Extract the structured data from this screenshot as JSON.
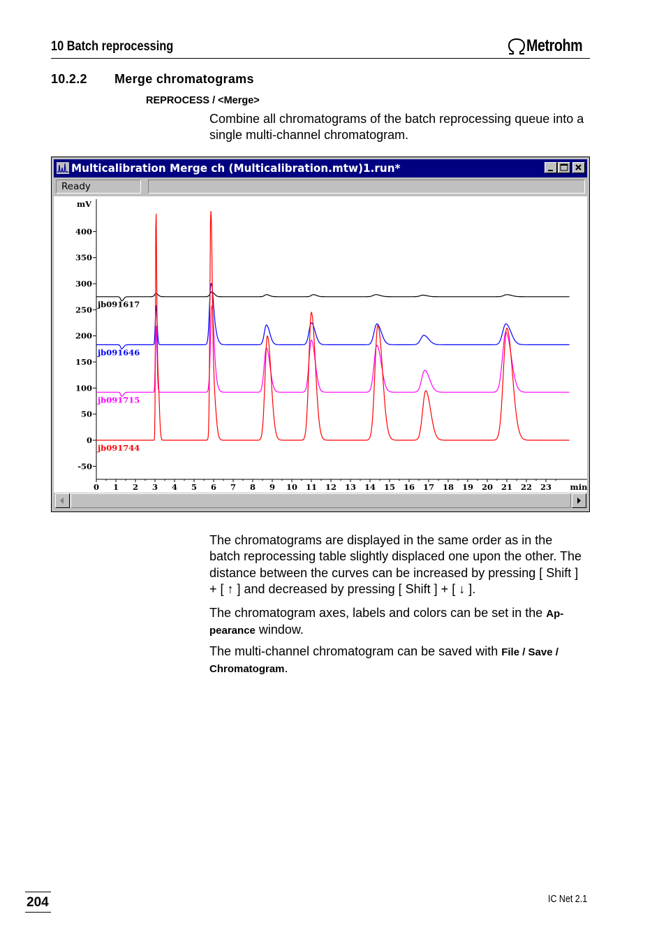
{
  "header": {
    "chapter": "10  Batch reprocessing",
    "logo": "Metrohm"
  },
  "section": {
    "number": "10.2.2",
    "title": "Merge chromatograms"
  },
  "menu_path": "REPROCESS / <Merge>",
  "intro": "Combine all chromatograms of the batch reprocessing queue into a single multi-channel chromatogram.",
  "window": {
    "title": "Multicalibration Merge ch (Multicalibration.mtw)1.run*",
    "status": "Ready"
  },
  "chart_data": {
    "type": "line",
    "ylabel": "mV",
    "xlabel": "min",
    "xlim": [
      0,
      24
    ],
    "ylim": [
      -50,
      460
    ],
    "x_ticks": [
      0,
      1,
      2,
      3,
      4,
      5,
      6,
      7,
      8,
      9,
      10,
      11,
      12,
      13,
      14,
      15,
      16,
      17,
      18,
      19,
      20,
      21,
      22,
      23
    ],
    "y_ticks": [
      -50,
      0,
      50,
      100,
      150,
      200,
      250,
      300,
      350,
      400
    ],
    "series": [
      {
        "name": "jb091617",
        "color": "#000000",
        "baseline": 275,
        "peaks": [
          [
            1.3,
            -8,
            0.08
          ],
          [
            3.05,
            6,
            0.1
          ],
          [
            5.9,
            9,
            0.12
          ],
          [
            8.7,
            4,
            0.14
          ],
          [
            11.1,
            4,
            0.15
          ],
          [
            14.3,
            4,
            0.2
          ],
          [
            16.7,
            3,
            0.2
          ],
          [
            21.0,
            4,
            0.22
          ]
        ]
      },
      {
        "name": "jb091646",
        "color": "#0000ff",
        "baseline": 183,
        "peaks": [
          [
            1.3,
            -8,
            0.08
          ],
          [
            3.05,
            75,
            0.05
          ],
          [
            5.85,
            88,
            0.1
          ],
          [
            5.95,
            40,
            0.15
          ],
          [
            8.7,
            38,
            0.15
          ],
          [
            11.0,
            42,
            0.17
          ],
          [
            14.35,
            40,
            0.2
          ],
          [
            16.75,
            18,
            0.22
          ],
          [
            20.95,
            40,
            0.23
          ]
        ]
      },
      {
        "name": "jb091715",
        "color": "#ff00ff",
        "baseline": 92,
        "peaks": [
          [
            1.3,
            -8,
            0.08
          ],
          [
            3.05,
            130,
            0.045
          ],
          [
            5.9,
            120,
            0.09
          ],
          [
            5.95,
            50,
            0.14
          ],
          [
            8.7,
            85,
            0.16
          ],
          [
            11.0,
            100,
            0.17
          ],
          [
            14.35,
            90,
            0.2
          ],
          [
            16.8,
            42,
            0.22
          ],
          [
            20.95,
            115,
            0.24
          ]
        ]
      },
      {
        "name": "jb091744",
        "color": "#ff0000",
        "baseline": 0,
        "peaks": [
          [
            3.05,
            435,
            0.035
          ],
          [
            3.15,
            120,
            0.06
          ],
          [
            5.85,
            375,
            0.06
          ],
          [
            5.95,
            120,
            0.12
          ],
          [
            8.75,
            200,
            0.17
          ],
          [
            11.0,
            245,
            0.18
          ],
          [
            14.4,
            220,
            0.21
          ],
          [
            16.85,
            95,
            0.22
          ],
          [
            21.0,
            215,
            0.25
          ]
        ]
      }
    ]
  },
  "body": {
    "p1": "The chromatograms are displayed in the same order as in the batch reprocessing table slightly displaced one upon the other. The distance between the curves can be increased by pressing [ Shift ] + [ ↑ ] and decreased by pressing [ Shift ] + [ ↓ ].",
    "p2_pre": "The chromatogram axes, labels and colors can be set in the ",
    "p2_bold": "Ap-pearance",
    "p2_post": " window.",
    "p3_pre": "The multi-channel chromatogram can be saved with ",
    "p3_bold": "File / Save / Chromatogram",
    "p3_post": "."
  },
  "footer": {
    "page": "204",
    "product": "IC Net 2.1"
  }
}
